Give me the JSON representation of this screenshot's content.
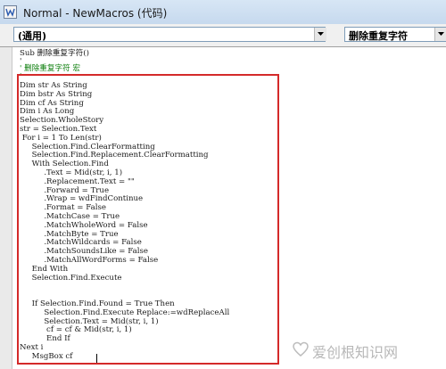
{
  "window": {
    "title": "Normal - NewMacros (代码)"
  },
  "combos": {
    "object_value": "(通用)",
    "procedure_value": "删除重复字符"
  },
  "code": {
    "header_line": "Sub 删除重复字符()",
    "header_quote": "'",
    "comment_line1": "' 删除重复字符 宏",
    "comment_line2": "'",
    "body_lines": [
      "Dim str As String",
      "Dim bstr As String",
      "Dim cf As String",
      "Dim i As Long",
      "Selection.WholeStory",
      "str = Selection.Text",
      " For i = 1 To Len(str)",
      "     Selection.Find.ClearFormatting",
      "     Selection.Find.Replacement.ClearFormatting",
      "     With Selection.Find",
      "          .Text = Mid(str, i, 1)",
      "          .Replacement.Text = \"\"",
      "          .Forward = True",
      "          .Wrap = wdFindContinue",
      "          .Format = False",
      "          .MatchCase = True",
      "          .MatchWholeWord = False",
      "          .MatchByte = True",
      "          .MatchWildcards = False",
      "          .MatchSoundsLike = False",
      "          .MatchAllWordForms = False",
      "     End With",
      "     Selection.Find.Execute",
      "",
      "",
      "     If Selection.Find.Found = True Then",
      "          Selection.Find.Execute Replace:=wdReplaceAll",
      "          Selection.Text = Mid(str, i, 1)",
      "           cf = cf & Mid(str, i, 1)",
      "           End If",
      "Next i",
      "     MsgBox cf"
    ]
  },
  "watermark": {
    "text": "爱创根知识网"
  },
  "colors": {
    "highlight_border": "#d42a2a",
    "comment_green": "#0a7d0a"
  }
}
